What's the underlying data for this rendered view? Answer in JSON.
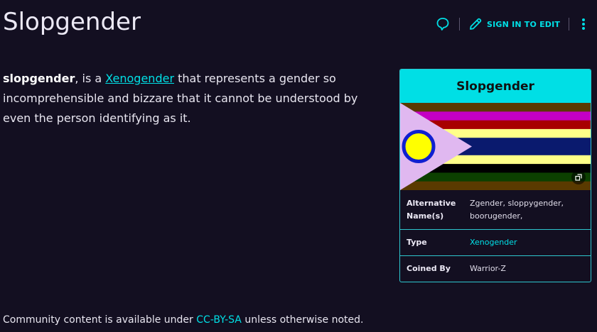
{
  "page": {
    "title": "Slopgender"
  },
  "actions": {
    "edit_label": "SIGN IN TO EDIT"
  },
  "article": {
    "term": "slopgender",
    "intro_mid": ", is a ",
    "link_text": "Xenogender",
    "rest": " that represents a gender so incomprehensible and bizzare that it cannot be understood by even the person identifying as it."
  },
  "infobox": {
    "title": "Slopgender",
    "rows": [
      {
        "label": "Alternative Name(s)",
        "value": "Zgender, sloppygender, boorugender,"
      },
      {
        "label": "Type",
        "value": "Xenogender"
      },
      {
        "label": "Coined By",
        "value": "Warrior-Z"
      }
    ]
  },
  "footer": {
    "prefix": "Community content is available under ",
    "license": "CC-BY-SA",
    "suffix": " unless otherwise noted."
  },
  "colors": {
    "background": "#130f21",
    "accent": "#00e0e6",
    "infobox_header": "#00dfe5"
  },
  "flag": {
    "stripes": [
      "#5a3a00",
      "#c400c4",
      "#a80000",
      "#ffff88",
      "#0a1a6e",
      "#0a1a6e",
      "#ffff88",
      "#000000",
      "#0c4000",
      "#5a3a00"
    ],
    "triangle": "#e0b8f0",
    "circle_fill": "#ffff00",
    "circle_ring": "#1020d0"
  }
}
